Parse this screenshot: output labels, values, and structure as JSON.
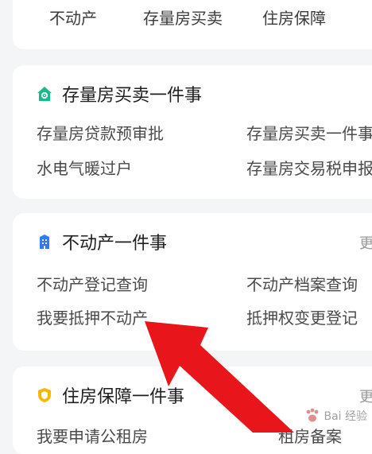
{
  "top_tabs": [
    "不动产",
    "存量房买卖",
    "住房保障"
  ],
  "cards": {
    "cunliang": {
      "title": "存量房买卖一件事",
      "items": [
        "存量房贷款预审批",
        "存量房买卖一件事",
        "水电气暖过户",
        "存量房交易税申报"
      ]
    },
    "budongchan": {
      "title": "不动产一件事",
      "items": [
        "不动产登记查询",
        "不动产档案查询",
        "我要抵押不动产",
        "抵押权变更登记"
      ]
    },
    "zhufang": {
      "title": "住房保障一件事",
      "items": [
        "我要申请公租房",
        "租房备案"
      ]
    }
  },
  "colors": {
    "green_icon": "#18b98a",
    "blue_icon": "#3478f6",
    "yellow_icon": "#f5b800",
    "arrow": "#e8151b"
  },
  "icons": [
    "house-icon",
    "building-icon",
    "shield-icon"
  ],
  "watermark": "Bai 经验"
}
